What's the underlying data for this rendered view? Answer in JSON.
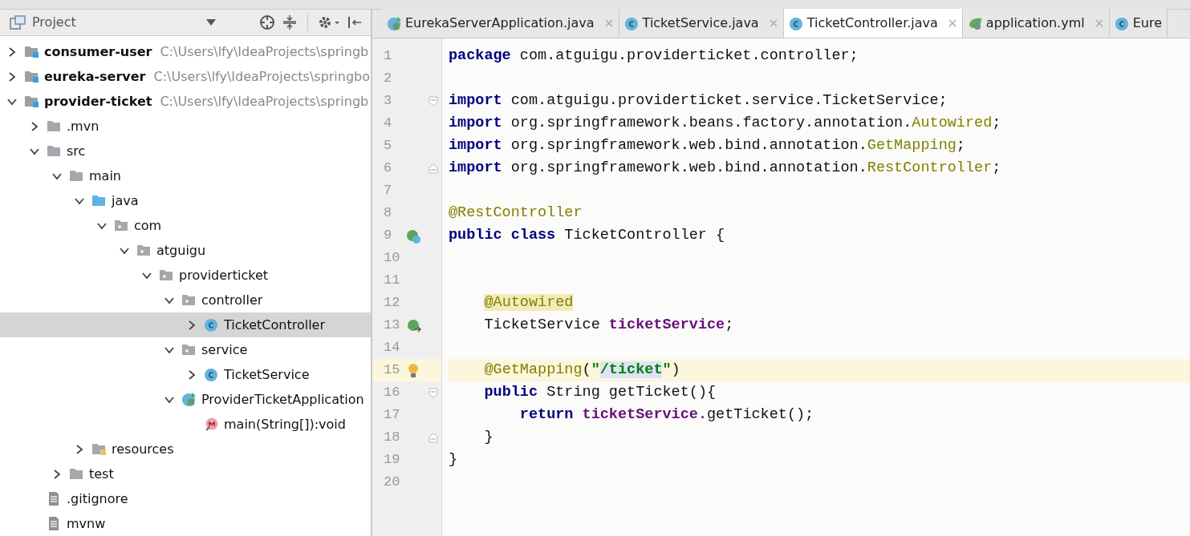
{
  "project_panel": {
    "title": "Project",
    "tree": [
      {
        "label": "consumer-user",
        "path": "C:\\Users\\lfy\\IdeaProjects\\springb",
        "kind": "module",
        "expanded": false,
        "selected": false
      },
      {
        "label": "eureka-server",
        "path": "C:\\Users\\lfy\\IdeaProjects\\springbo",
        "kind": "module",
        "expanded": false,
        "selected": false
      },
      {
        "label": "provider-ticket",
        "path": "C:\\Users\\lfy\\IdeaProjects\\springb",
        "kind": "module",
        "expanded": true,
        "selected": false,
        "children": [
          {
            "label": ".mvn",
            "kind": "folder",
            "expanded": false,
            "selected": false
          },
          {
            "label": "src",
            "kind": "folder",
            "expanded": true,
            "selected": false,
            "children": [
              {
                "label": "main",
                "kind": "folder",
                "expanded": true,
                "selected": false,
                "children": [
                  {
                    "label": "java",
                    "kind": "source",
                    "expanded": true,
                    "selected": false,
                    "children": [
                      {
                        "label": "com",
                        "kind": "package",
                        "expanded": true,
                        "selected": false,
                        "children": [
                          {
                            "label": "atguigu",
                            "kind": "package",
                            "expanded": true,
                            "selected": false,
                            "children": [
                              {
                                "label": "providerticket",
                                "kind": "package",
                                "expanded": true,
                                "selected": false,
                                "children": [
                                  {
                                    "label": "controller",
                                    "kind": "package",
                                    "expanded": true,
                                    "selected": false,
                                    "children": [
                                      {
                                        "label": "TicketController",
                                        "kind": "class",
                                        "expanded": false,
                                        "selected": true
                                      }
                                    ]
                                  },
                                  {
                                    "label": "service",
                                    "kind": "package",
                                    "expanded": true,
                                    "selected": false,
                                    "children": [
                                      {
                                        "label": "TicketService",
                                        "kind": "class",
                                        "expanded": false,
                                        "selected": false
                                      }
                                    ]
                                  },
                                  {
                                    "label": "ProviderTicketApplication",
                                    "kind": "app",
                                    "expanded": true,
                                    "selected": false,
                                    "children": [
                                      {
                                        "label": "main(String[]):void",
                                        "kind": "method",
                                        "selected": false
                                      }
                                    ]
                                  }
                                ]
                              }
                            ]
                          }
                        ]
                      }
                    ]
                  },
                  {
                    "label": "resources",
                    "kind": "resources",
                    "expanded": false,
                    "selected": false
                  }
                ]
              },
              {
                "label": "test",
                "kind": "folder",
                "expanded": false,
                "selected": false
              }
            ]
          },
          {
            "label": ".gitignore",
            "kind": "file",
            "selected": false
          },
          {
            "label": "mvnw",
            "kind": "file",
            "selected": false
          }
        ]
      }
    ]
  },
  "tabs": [
    {
      "label": "EurekaServerApplication.java",
      "kind": "app",
      "selected": false
    },
    {
      "label": "TicketService.java",
      "kind": "class",
      "selected": false
    },
    {
      "label": "TicketController.java",
      "kind": "class",
      "selected": true
    },
    {
      "label": "application.yml",
      "kind": "yml",
      "selected": false
    },
    {
      "label": "Eure",
      "kind": "class",
      "selected": false
    }
  ],
  "editor": {
    "lines": [
      {
        "number": "1",
        "current": false,
        "tokens": [
          {
            "text": "package",
            "kind": "keyword"
          },
          {
            "text": " com.atguigu.providerticket.controller;",
            "kind": "plain"
          }
        ]
      },
      {
        "number": "2",
        "current": false
      },
      {
        "number": "3",
        "current": false,
        "fold": {
          "kind": "start"
        },
        "tokens": [
          {
            "text": "import",
            "kind": "keyword"
          },
          {
            "text": " com.atguigu.providerticket.service.TicketService;",
            "kind": "plain"
          }
        ]
      },
      {
        "number": "4",
        "current": false,
        "tokens": [
          {
            "text": "import",
            "kind": "keyword"
          },
          {
            "text": " org.springframework.beans.factory.annotation.",
            "kind": "plain"
          },
          {
            "text": "Autowired",
            "kind": "annotation"
          },
          {
            "text": ";",
            "kind": "plain"
          }
        ]
      },
      {
        "number": "5",
        "current": false,
        "tokens": [
          {
            "text": "import",
            "kind": "keyword"
          },
          {
            "text": " org.springframework.web.bind.annotation.",
            "kind": "plain"
          },
          {
            "text": "GetMapping",
            "kind": "annotation"
          },
          {
            "text": ";",
            "kind": "plain"
          }
        ]
      },
      {
        "number": "6",
        "current": false,
        "fold": {
          "kind": "end"
        },
        "tokens": [
          {
            "text": "import",
            "kind": "keyword"
          },
          {
            "text": " org.springframework.web.bind.annotation.",
            "kind": "plain"
          },
          {
            "text": "RestController",
            "kind": "annotation"
          },
          {
            "text": ";",
            "kind": "plain"
          }
        ]
      },
      {
        "number": "7",
        "current": false
      },
      {
        "number": "8",
        "current": false,
        "tokens": [
          {
            "text": "@RestController",
            "kind": "annotation"
          }
        ]
      },
      {
        "number": "9",
        "current": false,
        "gutter": {
          "kind": "bean-class"
        },
        "tokens": [
          {
            "text": "public class",
            "kind": "keyword"
          },
          {
            "text": " TicketController {",
            "kind": "plain"
          }
        ]
      },
      {
        "number": "10",
        "current": false
      },
      {
        "number": "11",
        "current": false
      },
      {
        "number": "12",
        "current": false,
        "tokens": [
          {
            "text": "    @Autowired",
            "kind": "annotation-marked"
          }
        ]
      },
      {
        "number": "13",
        "current": false,
        "gutter": {
          "kind": "bean-inject"
        },
        "tokens": [
          {
            "text": "    TicketService ",
            "kind": "plain"
          },
          {
            "text": "ticketService",
            "kind": "field"
          },
          {
            "text": ";",
            "kind": "plain"
          }
        ]
      },
      {
        "number": "14",
        "current": false
      },
      {
        "number": "15",
        "current": true,
        "gutter": {
          "kind": "bulb"
        },
        "tokens": [
          {
            "text": "    @GetMapping",
            "kind": "annotation"
          },
          {
            "text": "(",
            "kind": "plain"
          },
          {
            "text": "\"",
            "kind": "string"
          },
          {
            "text": "/ticket",
            "kind": "string-selected"
          },
          {
            "text": "\"",
            "kind": "string"
          },
          {
            "text": ")",
            "kind": "plain"
          }
        ]
      },
      {
        "number": "16",
        "current": false,
        "fold": {
          "kind": "start"
        },
        "tokens": [
          {
            "text": "    public",
            "kind": "keyword"
          },
          {
            "text": " String getTicket(){",
            "kind": "plain"
          }
        ]
      },
      {
        "number": "17",
        "current": false,
        "tokens": [
          {
            "text": "        return",
            "kind": "keyword"
          },
          {
            "text": " ticketService",
            "kind": "field"
          },
          {
            "text": ".getTicket();",
            "kind": "plain"
          }
        ]
      },
      {
        "number": "18",
        "current": false,
        "fold": {
          "kind": "end"
        },
        "tokens": [
          {
            "text": "    }",
            "kind": "plain"
          }
        ]
      },
      {
        "number": "19",
        "current": false,
        "tokens": [
          {
            "text": "}",
            "kind": "plain"
          }
        ]
      },
      {
        "number": "20",
        "current": false
      }
    ]
  }
}
